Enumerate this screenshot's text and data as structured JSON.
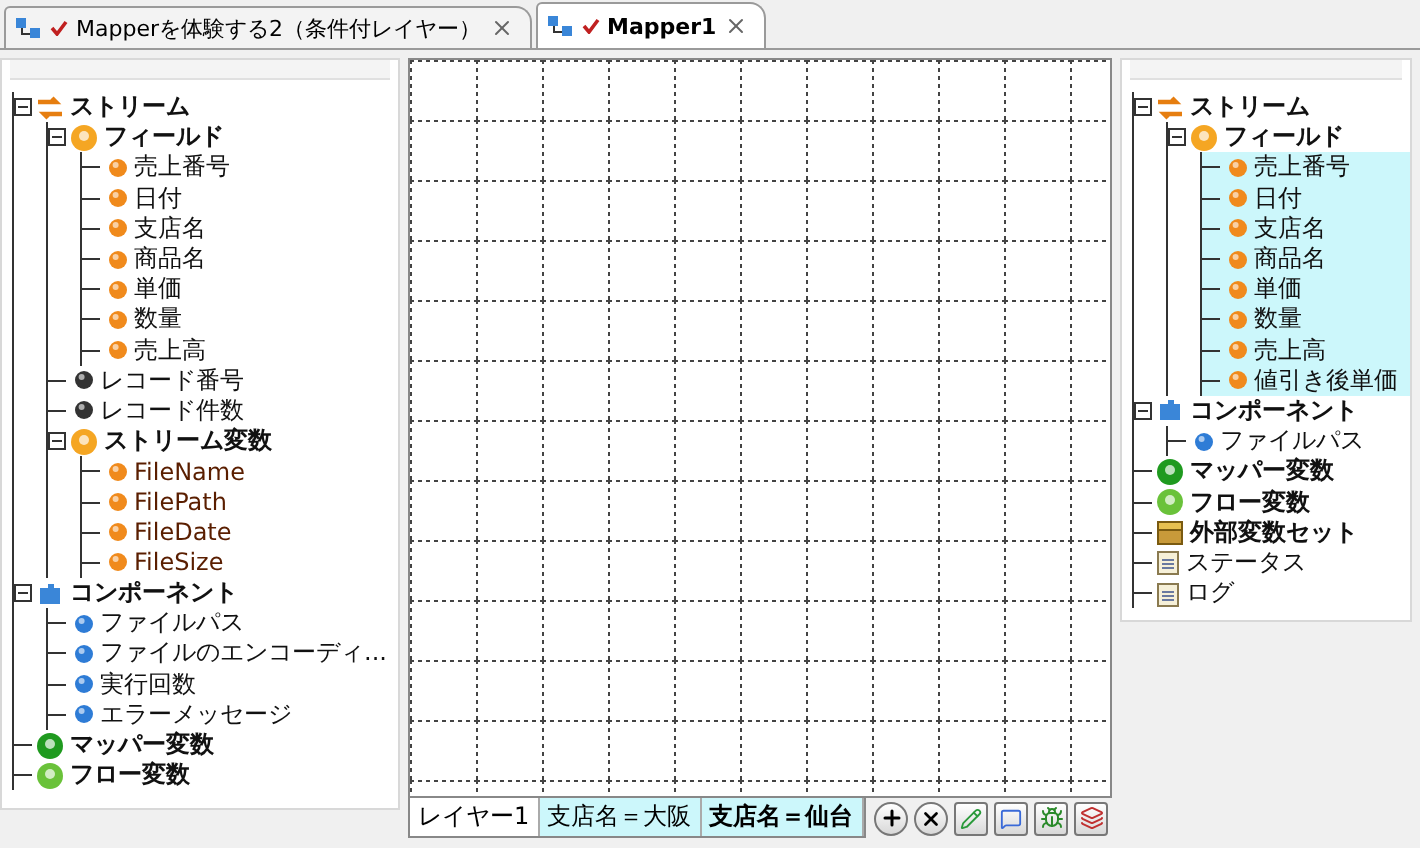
{
  "tabs": [
    {
      "label": "Mapperを体験する2（条件付レイヤー）",
      "selected": false
    },
    {
      "label": "Mapper1",
      "selected": true
    }
  ],
  "left_tree": [
    {
      "label": "ストリーム",
      "kind": "stream",
      "expanded": true,
      "children": [
        {
          "label": "フィールド",
          "kind": "field-group",
          "expanded": true,
          "children": [
            {
              "label": "売上番号",
              "kind": "field"
            },
            {
              "label": "日付",
              "kind": "field"
            },
            {
              "label": "支店名",
              "kind": "field"
            },
            {
              "label": "商品名",
              "kind": "field"
            },
            {
              "label": "単価",
              "kind": "field"
            },
            {
              "label": "数量",
              "kind": "field"
            },
            {
              "label": "売上高",
              "kind": "field"
            }
          ]
        },
        {
          "label": "レコード番号",
          "kind": "record"
        },
        {
          "label": "レコード件数",
          "kind": "record"
        },
        {
          "label": "ストリーム変数",
          "kind": "var-group",
          "expanded": true,
          "children": [
            {
              "label": "FileName",
              "kind": "stream-var"
            },
            {
              "label": "FilePath",
              "kind": "stream-var"
            },
            {
              "label": "FileDate",
              "kind": "stream-var"
            },
            {
              "label": "FileSize",
              "kind": "stream-var"
            }
          ]
        }
      ]
    },
    {
      "label": "コンポーネント",
      "kind": "component",
      "expanded": true,
      "children": [
        {
          "label": "ファイルパス",
          "kind": "comp-item"
        },
        {
          "label": "ファイルのエンコーディ...",
          "kind": "comp-item"
        },
        {
          "label": "実行回数",
          "kind": "comp-item"
        },
        {
          "label": "エラーメッセージ",
          "kind": "comp-item"
        }
      ]
    },
    {
      "label": "マッパー変数",
      "kind": "mapper-var"
    },
    {
      "label": "フロー変数",
      "kind": "flow-var"
    }
  ],
  "layer_tabs": [
    {
      "label": "レイヤー1",
      "kind": "default",
      "selected": false
    },
    {
      "label": "支店名＝大阪",
      "kind": "conditional",
      "selected": false
    },
    {
      "label": "支店名＝仙台",
      "kind": "conditional",
      "selected": true
    }
  ],
  "right_tree": [
    {
      "label": "ストリーム",
      "kind": "stream",
      "expanded": true,
      "children": [
        {
          "label": "フィールド",
          "kind": "field-group",
          "expanded": true,
          "children": [
            {
              "label": "売上番号",
              "kind": "field",
              "highlighted": true
            },
            {
              "label": "日付",
              "kind": "field",
              "highlighted": true
            },
            {
              "label": "支店名",
              "kind": "field",
              "highlighted": true
            },
            {
              "label": "商品名",
              "kind": "field",
              "highlighted": true
            },
            {
              "label": "単価",
              "kind": "field",
              "highlighted": true
            },
            {
              "label": "数量",
              "kind": "field",
              "highlighted": true
            },
            {
              "label": "売上高",
              "kind": "field",
              "highlighted": true
            },
            {
              "label": "値引き後単価",
              "kind": "field",
              "highlighted": true
            }
          ]
        }
      ]
    },
    {
      "label": "コンポーネント",
      "kind": "component",
      "expanded": true,
      "children": [
        {
          "label": "ファイルパス",
          "kind": "comp-item"
        }
      ]
    },
    {
      "label": "マッパー変数",
      "kind": "mapper-var"
    },
    {
      "label": "フロー変数",
      "kind": "flow-var"
    },
    {
      "label": "外部変数セット",
      "kind": "ext-var"
    },
    {
      "label": "ステータス",
      "kind": "status"
    },
    {
      "label": "ログ",
      "kind": "log"
    }
  ]
}
